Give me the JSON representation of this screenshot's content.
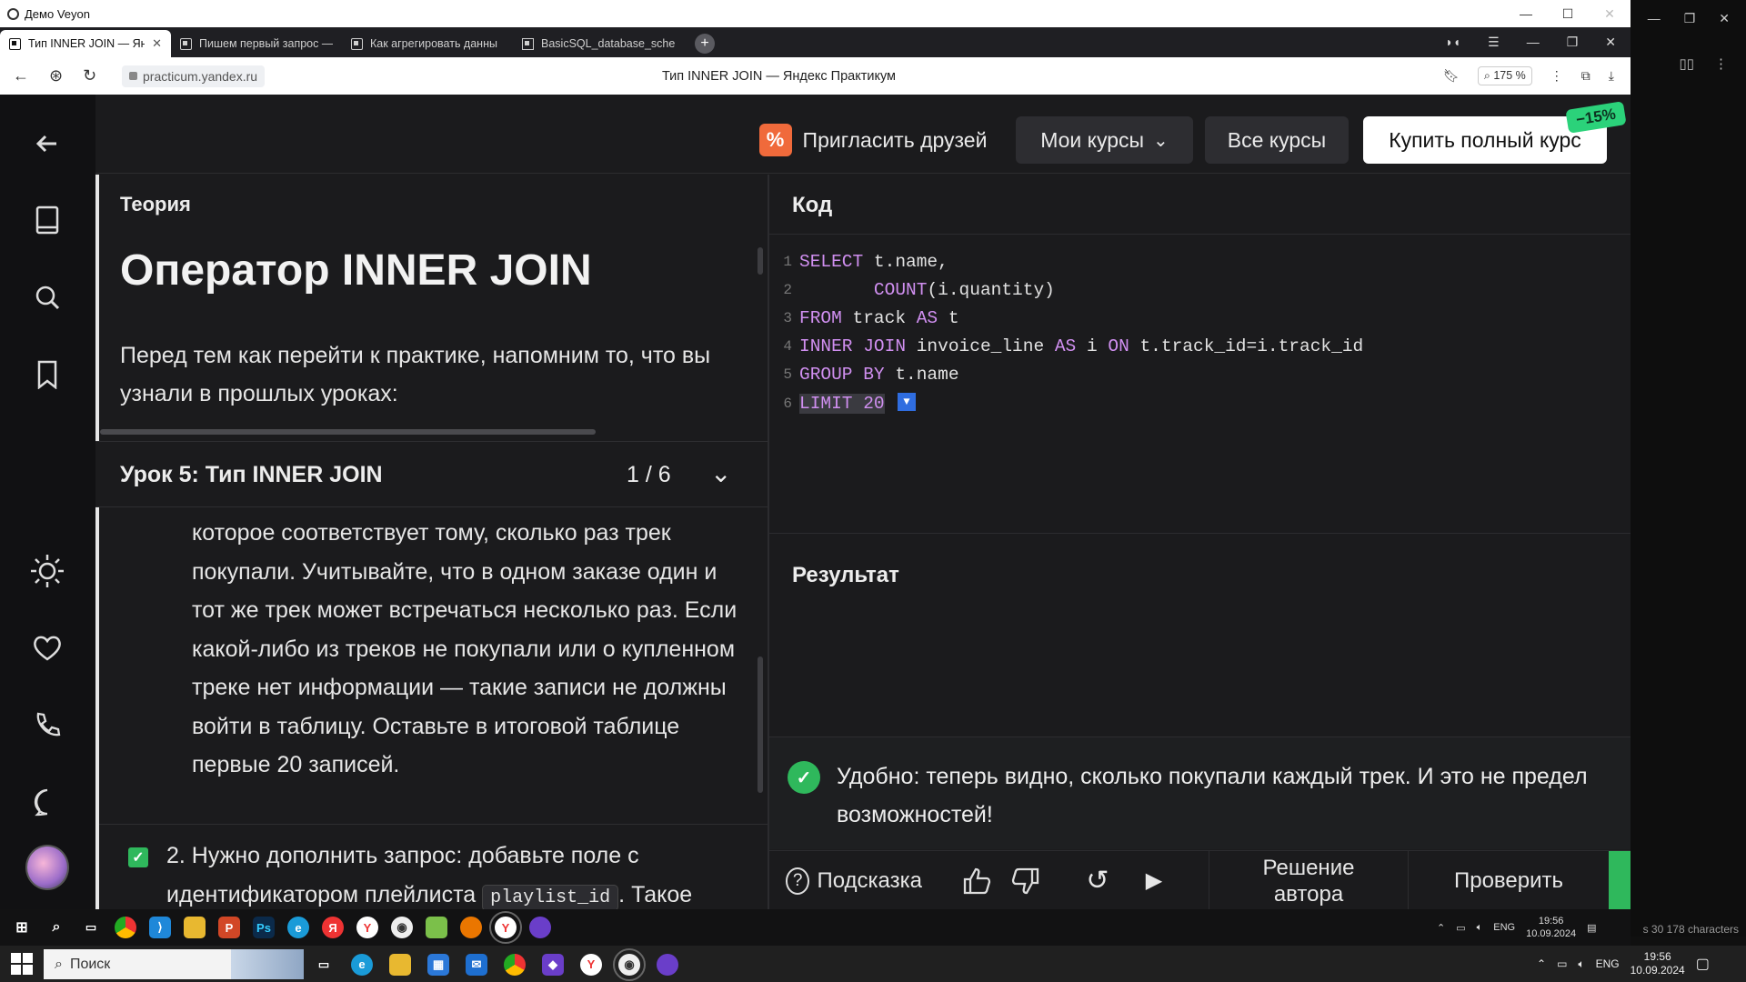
{
  "veyon": {
    "title": "Демо Veyon"
  },
  "tabs": [
    {
      "label": "Тип INNER JOIN — Янд",
      "active": true
    },
    {
      "label": "Пишем первый запрос —"
    },
    {
      "label": "Как агрегировать данны"
    },
    {
      "label": "BasicSQL_database_scher"
    }
  ],
  "address": {
    "url": "practicum.yandex.ru",
    "page_title": "Тип INNER JOIN — Яндекс Практикум",
    "zoom": "175 %"
  },
  "topbar": {
    "invite": "Пригласить друзей",
    "my_courses": "Мои курсы",
    "all_courses": "Все курсы",
    "buy": "Купить полный курс",
    "discount": "−15%"
  },
  "theory": {
    "label": "Теория",
    "title": "Оператор INNER JOIN",
    "intro": "Перед тем как перейти к практике, напомним то, что вы узнали в прошлых уроках:"
  },
  "lesson": {
    "title": "Урок 5: Тип INNER JOIN",
    "counter": "1 / 6"
  },
  "task": {
    "text": "которое соответствует тому, сколько раз трек покупали. Учитывайте, что в одном заказе один и тот же трек может встречаться несколько раз. Если какой-либо из треков не покупали или о купленном треке нет информации — такие записи не должны войти в таблицу. Оставьте в итоговой таблице первые 20 записей.",
    "task2_before": "2. Нужно дополнить запрос: добавьте поле с идентификатором плейлиста",
    "task2_code": "playlist_id",
    "task2_after": ". Такое"
  },
  "code_panel": {
    "label": "Код",
    "lines": [
      {
        "n": "1",
        "parts": [
          [
            "kw",
            "SELECT"
          ],
          [
            "tx",
            " t.name,"
          ]
        ]
      },
      {
        "n": "2",
        "parts": [
          [
            "tx",
            "       "
          ],
          [
            "kw",
            "COUNT"
          ],
          [
            "tx",
            "(i.quantity)"
          ]
        ]
      },
      {
        "n": "3",
        "parts": [
          [
            "kw",
            "FROM"
          ],
          [
            "tx",
            " track "
          ],
          [
            "kw",
            "AS"
          ],
          [
            "tx",
            " t"
          ]
        ]
      },
      {
        "n": "4",
        "parts": [
          [
            "kw",
            "INNER JOIN"
          ],
          [
            "tx",
            " invoice_line "
          ],
          [
            "kw",
            "AS"
          ],
          [
            "tx",
            " i "
          ],
          [
            "kw",
            "ON"
          ],
          [
            "tx",
            " t.track_id=i.track_id"
          ]
        ]
      },
      {
        "n": "5",
        "parts": [
          [
            "kw",
            "GROUP BY"
          ],
          [
            "tx",
            " t.name"
          ]
        ]
      },
      {
        "n": "6",
        "parts": [
          [
            "kw",
            "LIMIT"
          ],
          [
            "tx",
            " "
          ],
          [
            "kw",
            "20"
          ]
        ]
      }
    ]
  },
  "result": {
    "label": "Результат"
  },
  "feedback": {
    "text": "Удобно: теперь видно, сколько покупали каждый трек. И это не предел возможностей!"
  },
  "actions": {
    "hint": "Подсказка",
    "author_solution": "Решение автора",
    "check": "Проверить"
  },
  "taskbar": {
    "inner_lang": "ENG",
    "inner_time": "19:56",
    "inner_date": "10.09.2024",
    "chars": "s  30 178 characters",
    "search": "Поиск",
    "outer_lang": "ENG",
    "outer_time": "19:56",
    "outer_date": "10.09.2024"
  },
  "colors": {
    "accent_green": "#2fb85c",
    "keyword": "#d08ff0",
    "invite_orange": "#f06a3b"
  }
}
